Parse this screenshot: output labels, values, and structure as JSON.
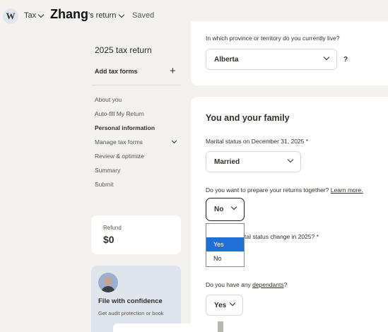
{
  "header": {
    "logo_letter": "W",
    "tax_menu_label": "Tax",
    "user_name": "Zhang",
    "return_label": "'s return",
    "save_status": "Saved"
  },
  "sidebar": {
    "title": "2025 tax return",
    "add_forms_label": "Add tax forms",
    "nav": [
      {
        "label": "About you"
      },
      {
        "label": "Auto-fill My Return"
      },
      {
        "label": "Personal information"
      },
      {
        "label": "Manage tax forms"
      },
      {
        "label": "Review & optimize"
      },
      {
        "label": "Summary"
      },
      {
        "label": "Submit"
      }
    ],
    "refund": {
      "label": "Refund",
      "value": "$0"
    },
    "confidence": {
      "title": "File with confidence",
      "text": "Get audit protection or book"
    }
  },
  "main": {
    "province": {
      "question": "In which province or territory do you currently live?",
      "value": "Alberta",
      "help": "?"
    },
    "family": {
      "title": "You and your family",
      "marital_question": "Marital status on December 31, 2025 *",
      "marital_value": "Married",
      "together_question": "Do you want to prepare your returns together?",
      "together_link": "Learn more.",
      "together_value": "No",
      "together_options": [
        "Yes",
        "No"
      ],
      "status_change_question": "tal status change in 2025? *",
      "dependants_question_before": "Do you have any ",
      "dependants_link": "dependants",
      "dependants_question_after": "?",
      "dependants_value": "Yes"
    }
  }
}
